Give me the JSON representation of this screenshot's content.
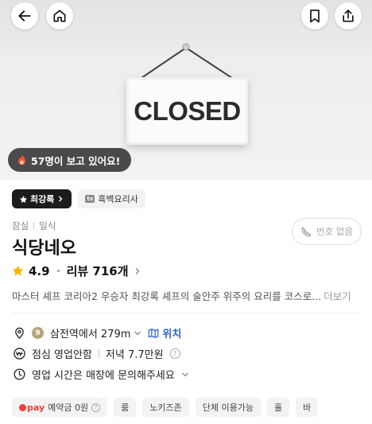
{
  "sign": {
    "text": "CLOSED"
  },
  "viewers": {
    "text": "57명이 보고 있어요!"
  },
  "tags": {
    "ranking": "최강록",
    "show": "흑백요리사",
    "tv_label": "tv"
  },
  "category": {
    "area": "잠실",
    "type": "일식"
  },
  "restaurant": {
    "name": "식당네오",
    "rating": "4.9",
    "reviews": "리뷰 716개"
  },
  "phone_button": {
    "label": "번호 없음"
  },
  "description": {
    "text": "마스터 셰프 코리아2 우승자 최강록 셰프의 술안주 위주의 요리를 코스로...",
    "more": "더보기"
  },
  "location": {
    "line_no": "9",
    "station": "삼전역에서 279m",
    "map_link": "위치"
  },
  "price": {
    "lunch": "점심 영업안함",
    "dinner": "저녁 7.7만원"
  },
  "hours": {
    "text": "영업 시간은 매장에 문의해주세요"
  },
  "chips": {
    "pay_brand": "pay",
    "deposit": "예약금 0원",
    "room": "룸",
    "no_kids": "노키즈존",
    "group": "단체 이용가능",
    "hall": "홀",
    "bar": "바"
  },
  "colors": {
    "accent_blue": "#2c62d6",
    "pay_red": "#ef3e36",
    "badge_dark": "#1c1c1c"
  }
}
